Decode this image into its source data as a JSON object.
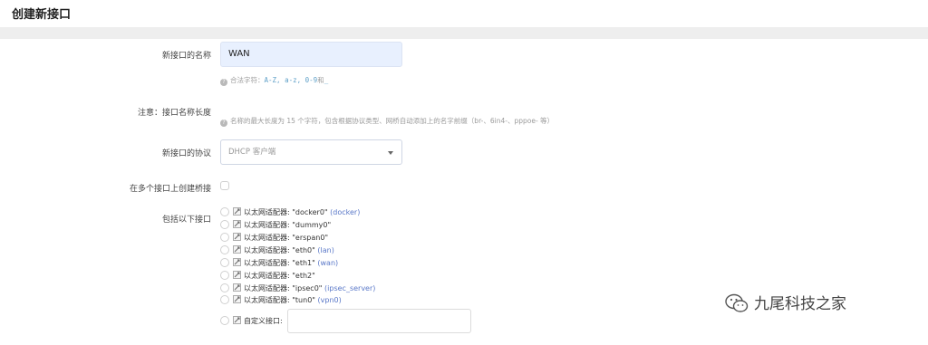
{
  "header": {
    "title": "创建新接口"
  },
  "form": {
    "name_label": "新接口的名称",
    "name_value": "WAN",
    "name_hint": "合法字符：",
    "name_hint_chars": "A-Z, a-z, 0-9",
    "name_hint_and": "和",
    "name_hint_underscore": "_",
    "note_label": "注意：接口名称长度",
    "note_hint": "名称的最大长度为 15 个字符，包含根据协议类型、网桥自动添加上的名字前缀（br-、6in4-、pppoe- 等）",
    "protocol_label": "新接口的协议",
    "protocol_value": "DHCP 客户端",
    "bridge_label": "在多个接口上创建桥接",
    "include_label": "包括以下接口"
  },
  "interfaces": [
    {
      "text": "以太网适配器: \"docker0\"",
      "tag": "(docker)"
    },
    {
      "text": "以太网适配器: \"dummy0\"",
      "tag": ""
    },
    {
      "text": "以太网适配器: \"erspan0\"",
      "tag": ""
    },
    {
      "text": "以太网适配器: \"eth0\"",
      "tag": "(lan)"
    },
    {
      "text": "以太网适配器: \"eth1\"",
      "tag": "(wan)"
    },
    {
      "text": "以太网适配器: \"eth2\"",
      "tag": ""
    },
    {
      "text": "以太网适配器: \"ipsec0\"",
      "tag": "(ipsec_server)"
    },
    {
      "text": "以太网适配器: \"tun0\"",
      "tag": "(vpn0)"
    }
  ],
  "custom_interface": {
    "label": "自定义接口:"
  },
  "watermark": {
    "text": "九尾科技之家",
    "icon": "wechat-icon"
  },
  "colors": {
    "input_bg": "#e8f0fe",
    "link": "#5a78c8",
    "band": "#eeeeee"
  }
}
